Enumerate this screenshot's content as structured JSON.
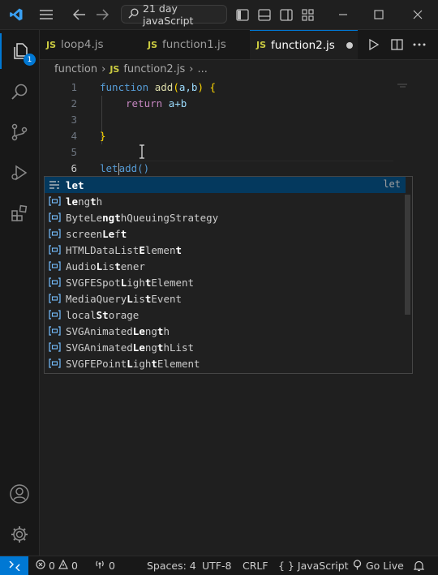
{
  "titlebar": {
    "search_text": "21 day javaScript",
    "accent": "#0078d4"
  },
  "activity": {
    "explorer_badge": "1"
  },
  "tabs": [
    {
      "label": "loop4.js",
      "icon": "JS"
    },
    {
      "label": "function1.js",
      "icon": "JS"
    },
    {
      "label": "function2.js",
      "icon": "JS",
      "active": true,
      "dirty": true
    }
  ],
  "breadcrumb": {
    "folder": "function",
    "file": "function2.js",
    "more": "..."
  },
  "editor": {
    "line_numbers": [
      "1",
      "2",
      "3",
      "4",
      "5",
      "6"
    ],
    "line1": {
      "kw": "function",
      "name": "add",
      "open": "(",
      "params": "a,b",
      "close": ")",
      "brace": "{"
    },
    "line2": {
      "kw": "return",
      "expr": "a+b"
    },
    "line4": {
      "brace": "}"
    },
    "line6": {
      "before": "let",
      "after": "add()"
    }
  },
  "suggest": {
    "detail": "let",
    "items": [
      {
        "pre": "",
        "bold": "let",
        "post": ""
      },
      {
        "pre": "",
        "bold": "le",
        "mid": "ng",
        "bold2": "t",
        "post": "h"
      },
      {
        "pre": "ByteLe",
        "bold": "ngt",
        "post": "hQueuingStrategy"
      },
      {
        "pre": "screen",
        "bold": "Le",
        "mid": "f",
        "bold2": "t",
        "post": ""
      },
      {
        "pre": "HTMLDataList",
        "bold": "E",
        "mid": "lemen",
        "bold2": "t",
        "post": ""
      },
      {
        "pre": "Audio",
        "bold": "L",
        "mid": "is",
        "bold2": "t",
        "post": "ener"
      },
      {
        "pre": "SVGFESpot",
        "bold": "L",
        "mid": "igh",
        "bold2": "t",
        "post": "Element"
      },
      {
        "pre": "MediaQuery",
        "bold": "L",
        "mid": "is",
        "bold2": "t",
        "post": "Event"
      },
      {
        "pre": "local",
        "bold": "S",
        "mid": "",
        "bold2": "t",
        "post": "orage"
      },
      {
        "pre": "SVGAnimated",
        "bold": "Le",
        "mid": "ng",
        "bold2": "t",
        "post": "h"
      },
      {
        "pre": "SVGAnimated",
        "bold": "Le",
        "mid": "ng",
        "bold2": "t",
        "post": "hList"
      },
      {
        "pre": "SVGFEPoint",
        "bold": "L",
        "mid": "igh",
        "bold2": "t",
        "post": "Element"
      }
    ]
  },
  "status": {
    "errors": "0",
    "warnings": "0",
    "ports": "0",
    "spaces": "Spaces: 4",
    "encoding": "UTF-8",
    "eol": "CRLF",
    "language": "JavaScript",
    "golive": "Go Live"
  }
}
